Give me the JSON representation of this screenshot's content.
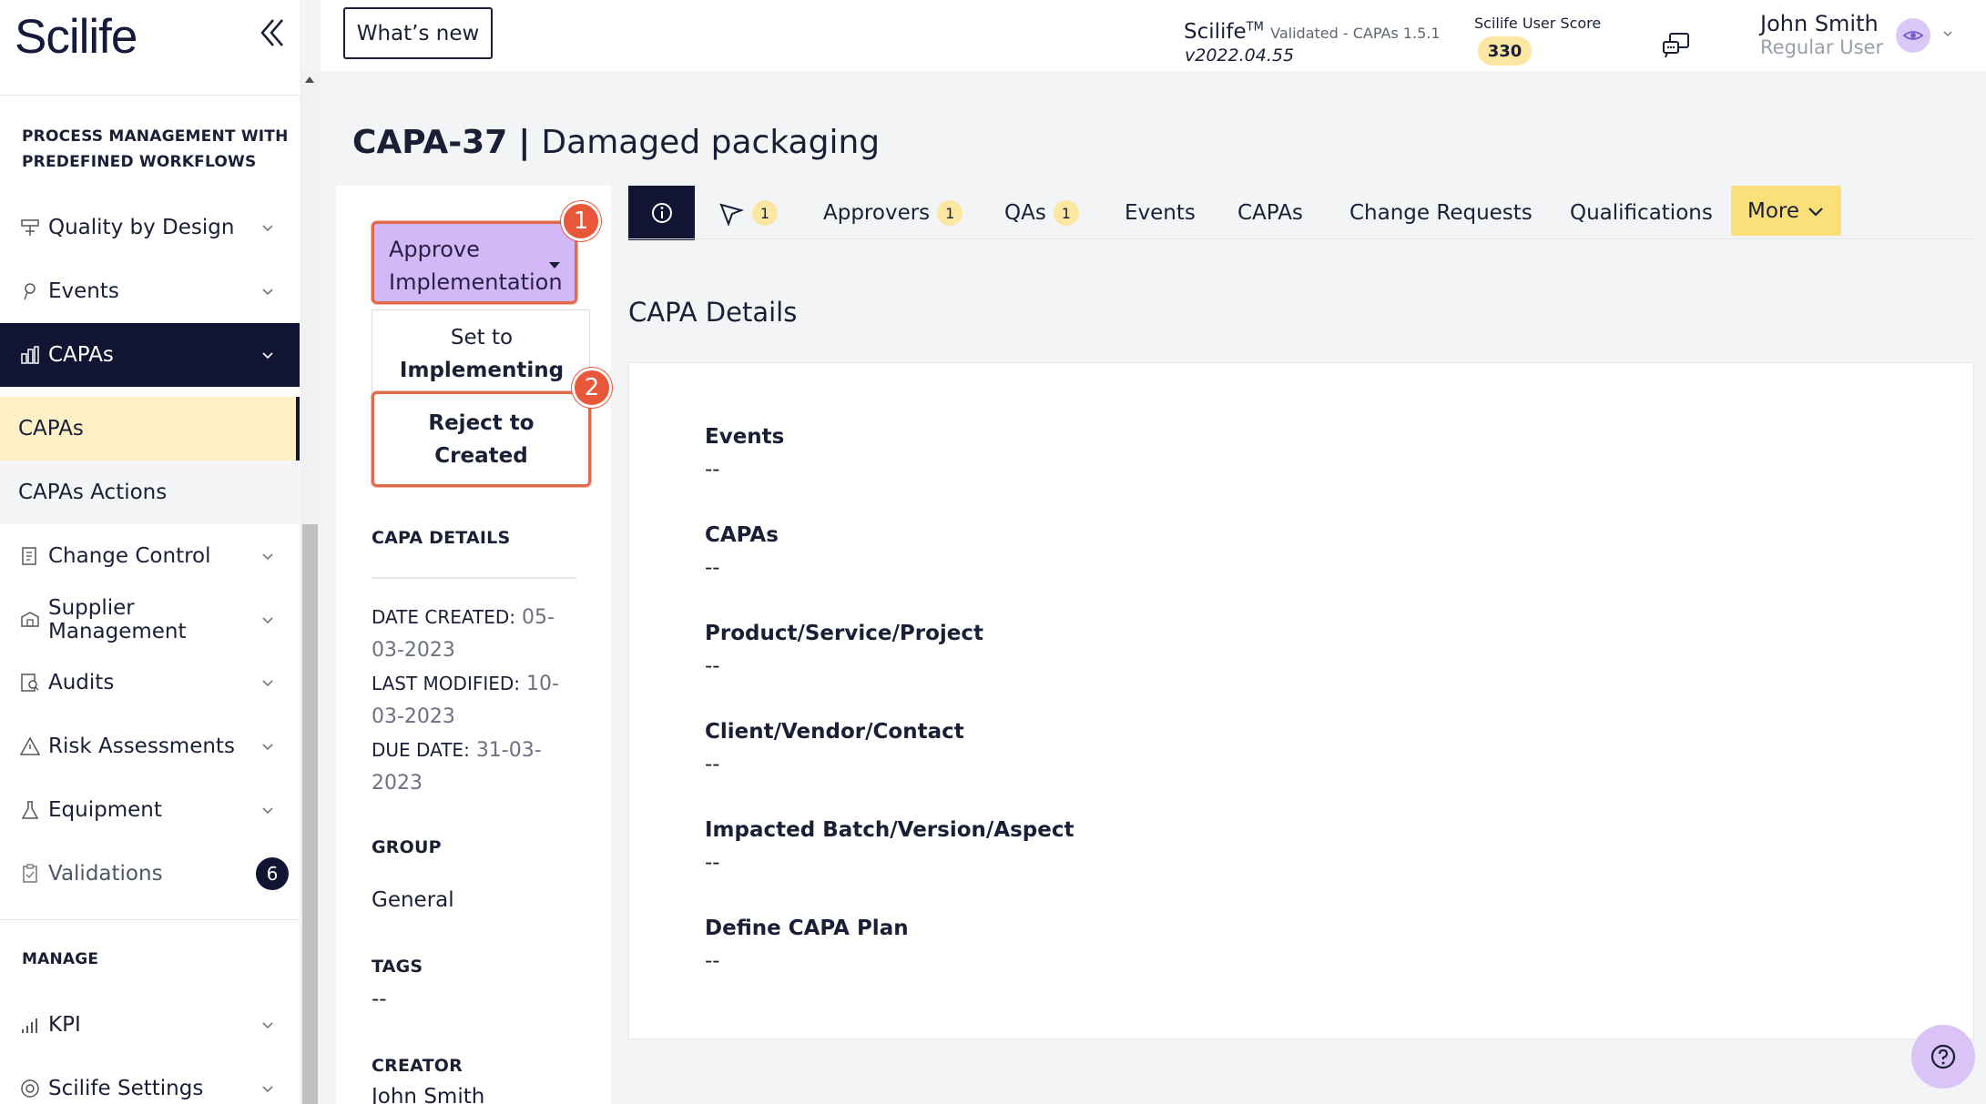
{
  "app": {
    "logo": "Scilife",
    "whats_new": "What’s new",
    "version_brand": "Scilife",
    "version_tm": "TM",
    "version_module": "Validated - CAPAs 1.5.1",
    "version_number": "v2022.04.55",
    "score_label": "Scilife User Score",
    "score_value": "330",
    "user_name": "John Smith",
    "user_role": "Regular User"
  },
  "sidebar": {
    "section_process_line1": "PROCESS MANAGEMENT WITH",
    "section_process_line2": "PREDEFINED WORKFLOWS",
    "items": [
      {
        "label": "Quality by Design",
        "icon": "quality-design-icon"
      },
      {
        "label": "Events",
        "icon": "pin-icon"
      },
      {
        "label": "CAPAs",
        "icon": "capa-icon"
      },
      {
        "label": "CAPAs"
      },
      {
        "label": "CAPAs Actions"
      },
      {
        "label": "Change Control",
        "icon": "change-control-icon"
      },
      {
        "label": "Supplier Management",
        "icon": "supplier-icon"
      },
      {
        "label": "Audits",
        "icon": "audit-icon"
      },
      {
        "label": "Risk Assessments",
        "icon": "warning-icon"
      },
      {
        "label": "Equipment",
        "icon": "equipment-icon"
      },
      {
        "label": "Validations",
        "icon": "clipboard-icon",
        "badge": "6"
      }
    ],
    "section_manage": "MANAGE",
    "manage_items": [
      {
        "label": "KPI",
        "icon": "kpi-icon"
      },
      {
        "label": "Scilife Settings",
        "icon": "settings-icon"
      }
    ]
  },
  "page": {
    "id": "CAPA-37",
    "separator": "|",
    "title": "Damaged packaging"
  },
  "actions": {
    "primary_line1": "Approve",
    "primary_line2": "Implementation",
    "badge1": "1",
    "set_to": "Set to",
    "set_to_state": "Implementing",
    "reject_line1": "Reject to",
    "reject_line2": "Created",
    "badge2": "2"
  },
  "left_panel": {
    "details_heading": "CAPA DETAILS",
    "date_created_key": "DATE CREATED:",
    "date_created_val_a": "05-",
    "date_created_val_b": "03-2023",
    "last_modified_key": "LAST MODIFIED:",
    "last_modified_val_a": "10-",
    "last_modified_val_b": "03-2023",
    "due_date_key": "DUE DATE:",
    "due_date_val_a": "31-03-",
    "due_date_val_b": "2023",
    "group_heading": "GROUP",
    "group_value": "General",
    "tags_heading": "TAGS",
    "tags_value": "--",
    "creator_heading": "CREATOR",
    "creator_value": "John Smith"
  },
  "tabs": {
    "flow_count": "1",
    "approvers": "Approvers",
    "approvers_count": "1",
    "qas": "QAs",
    "qas_count": "1",
    "events": "Events",
    "capas": "CAPAs",
    "change_requests": "Change Requests",
    "qualifications": "Qualifications",
    "more": "More"
  },
  "details": {
    "title": "CAPA Details",
    "fields": [
      {
        "label": "Events",
        "value": "--"
      },
      {
        "label": "CAPAs",
        "value": "--"
      },
      {
        "label": "Product/Service/Project",
        "value": "--"
      },
      {
        "label": "Client/Vendor/Contact",
        "value": "--"
      },
      {
        "label": "Impacted Batch/Version/Aspect",
        "value": "--"
      },
      {
        "label": "Define CAPA Plan",
        "value": "--"
      }
    ]
  },
  "colors": {
    "navy": "#111433",
    "accent_purple": "#d3b8f7",
    "highlight_yellow": "#fdf0c6",
    "annotation_red": "#e8573a"
  }
}
